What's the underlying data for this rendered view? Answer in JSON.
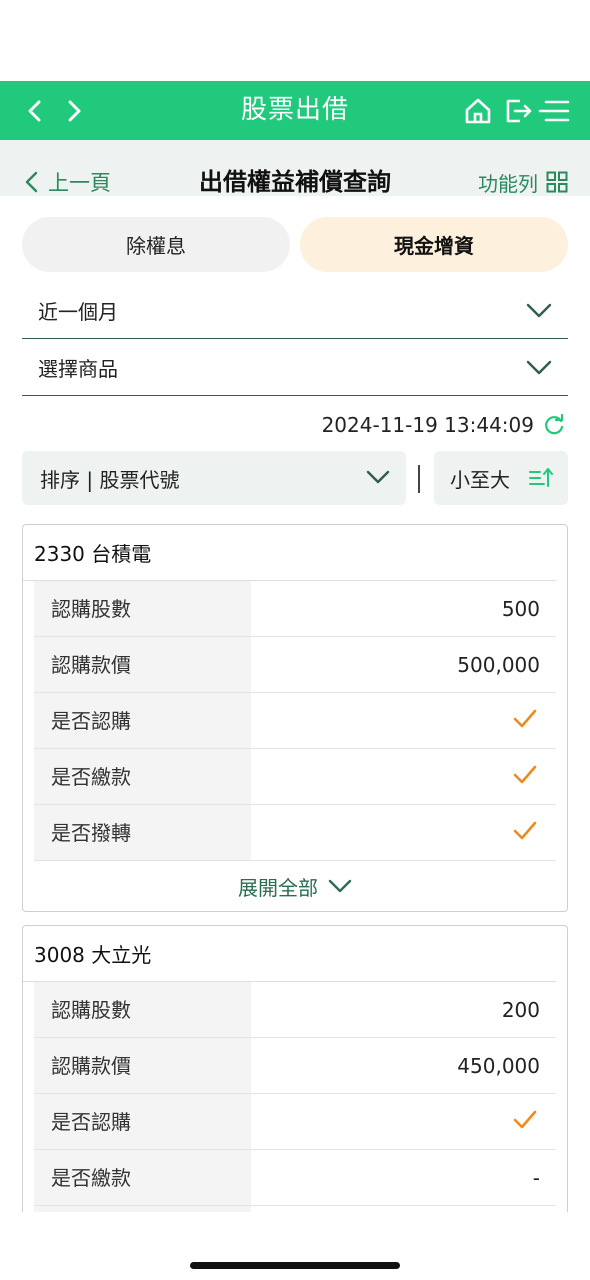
{
  "nav": {
    "title": "股票出借"
  },
  "subhead": {
    "back_label": "上一頁",
    "title": "出借權益補償查詢",
    "func_label": "功能列"
  },
  "tabs": [
    {
      "label": "除權息"
    },
    {
      "label": "現金增資"
    }
  ],
  "filters": {
    "period": "近一個月",
    "product": "選擇商品"
  },
  "timestamp": "2024-11-19 13:44:09",
  "sort": {
    "field_label": "排序 | 股票代號",
    "order_label": "小至大"
  },
  "cards": [
    {
      "title": "2330 台積電",
      "rows": [
        {
          "label": "認購股數",
          "value": "500"
        },
        {
          "label": "認購款價",
          "value": "500,000"
        },
        {
          "label": "是否認購",
          "value": "✓"
        },
        {
          "label": "是否繳款",
          "value": "✓"
        },
        {
          "label": "是否撥轉",
          "value": "✓"
        }
      ],
      "expand_label": "展開全部"
    },
    {
      "title": "3008 大立光",
      "rows": [
        {
          "label": "認購股數",
          "value": "200"
        },
        {
          "label": "認購款價",
          "value": "450,000"
        },
        {
          "label": "是否認購",
          "value": "✓"
        },
        {
          "label": "是否繳款",
          "value": "-"
        }
      ]
    }
  ],
  "colors": {
    "brand": "#20c97c",
    "accent_text": "#2a8a5e",
    "check": "#f08a1c",
    "active_tab": "#fdf0dc"
  }
}
